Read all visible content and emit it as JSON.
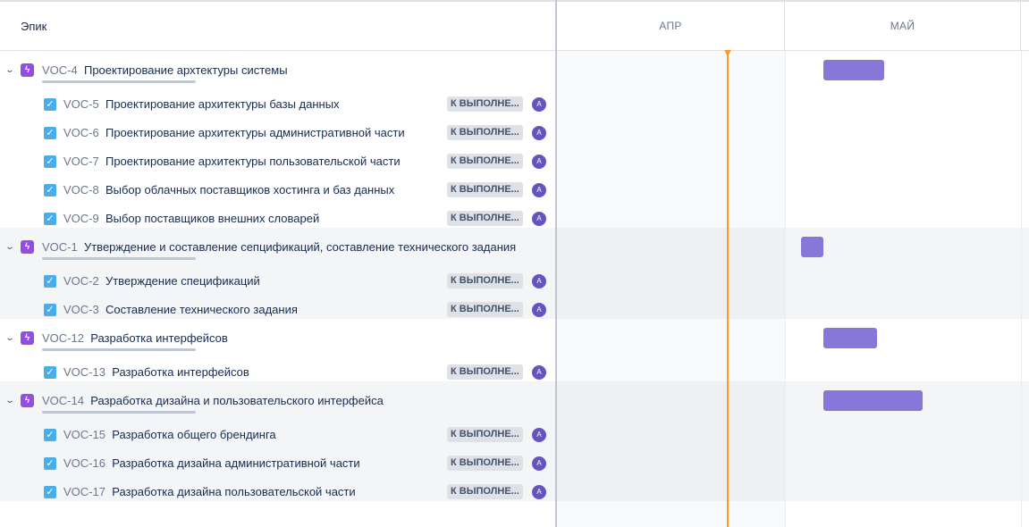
{
  "header": {
    "list_label": "Эпик",
    "months": [
      "АПР",
      "МАЙ"
    ]
  },
  "colors": {
    "epic": "#904ee2",
    "task": "#4bade8",
    "bar": "#8777d9",
    "today": "#ff991f",
    "avatar": "#6554c0",
    "status_bg": "#dfe1e6"
  },
  "icons": {
    "toggle": "chevron-down-icon",
    "epic": "lightning-icon",
    "task": "checkbox-icon"
  },
  "epics": [
    {
      "key": "VOC-4",
      "summary": "Проектирование архтектуры системы",
      "toggle": "⌄",
      "icon": "ϟ",
      "tasks": [
        {
          "key": "VOC-5",
          "summary": "Проектирование архитектуры базы данных",
          "status": "К ВЫПОЛНЕ...",
          "avatar": "А",
          "check": "✓"
        },
        {
          "key": "VOC-6",
          "summary": "Проектирование архитектуры административной части",
          "status": "К ВЫПОЛНЕ...",
          "avatar": "А",
          "check": "✓"
        },
        {
          "key": "VOC-7",
          "summary": "Проектирование архитектуры пользовательской части",
          "status": "К ВЫПОЛНЕ...",
          "avatar": "А",
          "check": "✓"
        },
        {
          "key": "VOC-8",
          "summary": "Выбор облачных поставщиков хостинга и баз данных",
          "status": "К ВЫПОЛНЕ...",
          "avatar": "А",
          "check": "✓"
        },
        {
          "key": "VOC-9",
          "summary": "Выбор поставщиков внешних словарей",
          "status": "К ВЫПОЛНЕ...",
          "avatar": "А",
          "check": "✓"
        }
      ]
    },
    {
      "key": "VOC-1",
      "summary": "Утверждение и составление сепцификаций, составление технического задания",
      "toggle": "⌄",
      "icon": "ϟ",
      "tasks": [
        {
          "key": "VOC-2",
          "summary": "Утверждение спецификаций",
          "status": "К ВЫПОЛНЕ...",
          "avatar": "А",
          "check": "✓"
        },
        {
          "key": "VOC-3",
          "summary": "Составление технического задания",
          "status": "К ВЫПОЛНЕ...",
          "avatar": "А",
          "check": "✓"
        }
      ]
    },
    {
      "key": "VOC-12",
      "summary": "Разработка интерфейсов",
      "toggle": "⌄",
      "icon": "ϟ",
      "tasks": [
        {
          "key": "VOC-13",
          "summary": "Разработка интерфейсов",
          "status": "К ВЫПОЛНЕ...",
          "avatar": "А",
          "check": "✓"
        }
      ]
    },
    {
      "key": "VOC-14",
      "summary": "Разработка дизайна и пользовательского интерфейса",
      "toggle": "⌄",
      "icon": "ϟ",
      "tasks": [
        {
          "key": "VOC-15",
          "summary": "Разработка общего брендинга",
          "status": "К ВЫПОЛНЕ...",
          "avatar": "А",
          "check": "✓"
        },
        {
          "key": "VOC-16",
          "summary": "Разработка дизайна административной части",
          "status": "К ВЫПОЛНЕ...",
          "avatar": "А",
          "check": "✓"
        },
        {
          "key": "VOC-17",
          "summary": "Разработка дизайна пользовательской части",
          "status": "К ВЫПОЛНЕ...",
          "avatar": "А",
          "check": "✓"
        }
      ]
    }
  ]
}
